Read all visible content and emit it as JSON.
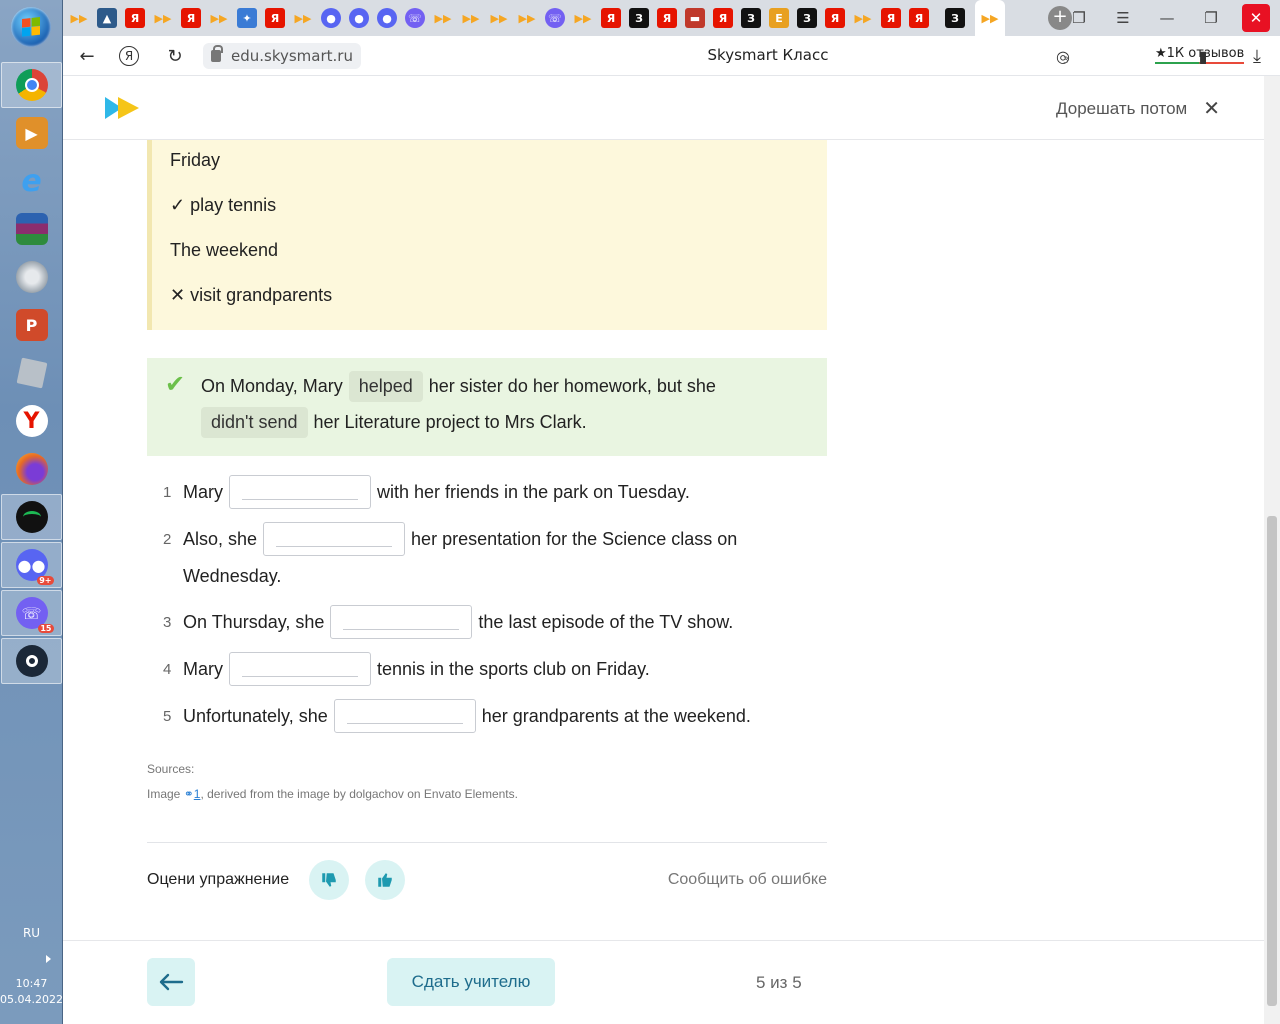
{
  "taskbar": {
    "language": "RU",
    "time": "10:47",
    "date": "05.04.2022",
    "apps": [
      {
        "name": "chrome",
        "color": "#d23f31",
        "glyph": ""
      },
      {
        "name": "media-player",
        "color": "#e0902a",
        "glyph": "▶"
      },
      {
        "name": "internet-explorer",
        "color": "#2a79d0",
        "glyph": "e"
      },
      {
        "name": "winrar",
        "color": "#8b2d6e",
        "glyph": ""
      },
      {
        "name": "speaker",
        "color": "#9aa4ad",
        "glyph": ""
      },
      {
        "name": "powerpoint",
        "color": "#d04a2a",
        "glyph": ""
      },
      {
        "name": "roblox",
        "color": "#b8c0c8",
        "glyph": ""
      },
      {
        "name": "yandex-browser",
        "color": "#ffffff",
        "glyph": "Y"
      },
      {
        "name": "firefox",
        "color": "#e66a24",
        "glyph": ""
      },
      {
        "name": "spotify",
        "color": "#1db954",
        "glyph": ""
      },
      {
        "name": "discord",
        "color": "#5865f2",
        "glyph": ""
      },
      {
        "name": "viber",
        "color": "#7360f2",
        "glyph": ""
      },
      {
        "name": "steam",
        "color": "#1b2838",
        "glyph": ""
      }
    ]
  },
  "browser": {
    "url": "edu.skysmart.ru",
    "title": "Skysmart Класс",
    "reviews": "★1К отзывов",
    "extension_badge": "3"
  },
  "header": {
    "later_label": "Дорешать потом"
  },
  "schedule": {
    "day1": "Friday",
    "item1": "✓ play tennis",
    "day2": "The weekend",
    "item2": "✕ visit grandparents"
  },
  "example": {
    "part1": "On Monday, Mary",
    "answer1": "helped",
    "part2": "her sister do her homework, but she",
    "answer2": "didn't send",
    "part3": "her Literature project to Mrs Clark."
  },
  "questions": [
    {
      "num": "1",
      "before": "Mary",
      "after": "with her friends in the park on Tuesday."
    },
    {
      "num": "2",
      "before": "Also, she",
      "after": "her presentation for the Science class on",
      "after2": "Wednesday."
    },
    {
      "num": "3",
      "before": "On Thursday, she",
      "after": "the last episode of the TV show."
    },
    {
      "num": "4",
      "before": "Mary",
      "after": "tennis in the sports club on Friday."
    },
    {
      "num": "5",
      "before": "Unfortunately, she",
      "after": "her grandparents at the weekend."
    }
  ],
  "sources": {
    "heading": "Sources:",
    "prefix": "Image",
    "link": "1",
    "text": ", derived from the image by dolgachov on Envato Elements."
  },
  "rating": {
    "label": "Оцени упражнение",
    "report": "Сообщить об ошибке"
  },
  "footer": {
    "submit": "Сдать учителю",
    "pager": "5 из 5"
  },
  "colors": {
    "accent": "#1e6c8c",
    "button_bg": "#d9f3f3",
    "yellow_card": "#fdf8dc",
    "green_card": "#e9f5e1",
    "check_green": "#6cc04a"
  }
}
